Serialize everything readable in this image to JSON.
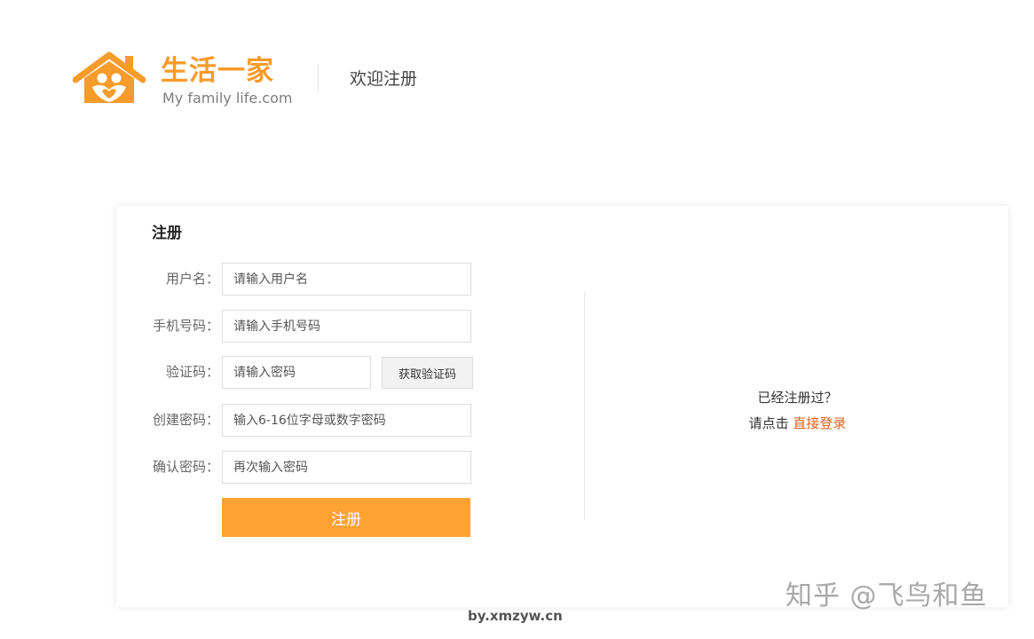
{
  "header": {
    "brand_name": "生活一家",
    "brand_slogan": "My family life.com",
    "page_title": "欢迎注册",
    "brand_color": "#f79b2a",
    "slogan_color": "#7d7d7d",
    "logo_icon": "house-family-logo"
  },
  "form": {
    "title": "注册",
    "fields": [
      {
        "label": "用户名：",
        "placeholder": "请输入用户名"
      },
      {
        "label": "手机号码：",
        "placeholder": "请输入手机号码"
      },
      {
        "label": "验证码：",
        "placeholder": "请输入密码"
      },
      {
        "label": "创建密码：",
        "placeholder": "输入6-16位字母或数字密码"
      },
      {
        "label": "确认密码：",
        "placeholder": "再次输入密码"
      }
    ],
    "get_code_label": "获取验证码",
    "submit_label": "注册",
    "submit_color": "#fea233"
  },
  "login_hint": {
    "question": "已经注册过？",
    "prefix": "请点击 ",
    "link_label": "直接登录",
    "link_color": "#e0621b"
  },
  "watermarks": {
    "bottom": "by.xmzyw.cn",
    "corner": "知乎 @飞鸟和鱼"
  }
}
